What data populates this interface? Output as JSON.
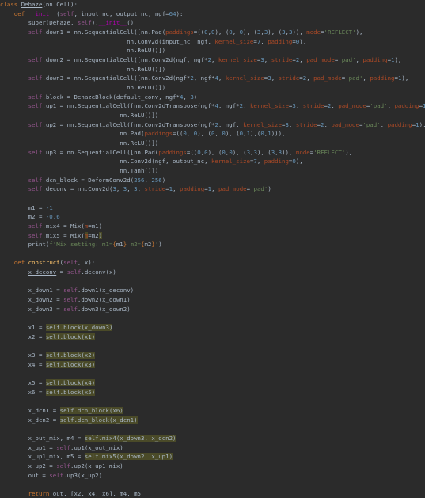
{
  "editor": {
    "language": "python",
    "theme_colors": {
      "background": "#2b2b2b",
      "default": "#a9b7c6",
      "keyword": "#cc7832",
      "self": "#94558d",
      "dunder": "#b200b2",
      "kwarg": "#aa4926",
      "number": "#6897bb",
      "string": "#6a8759",
      "function_name": "#ffc66d",
      "fstring_brace": "#cc7832",
      "highlight_bg": "#4a4a28"
    },
    "lines": [
      [
        {
          "t": "class ",
          "c": "kw"
        },
        {
          "t": "Dehaze",
          "c": "ul"
        },
        {
          "t": "(nn.Cell):"
        }
      ],
      [
        {
          "t": "    "
        },
        {
          "t": "def ",
          "c": "kw"
        },
        {
          "t": "__init__",
          "c": "dunder"
        },
        {
          "t": "("
        },
        {
          "t": "self",
          "c": "self"
        },
        {
          "t": ", input_nc, output_nc, ngf="
        },
        {
          "t": "64",
          "c": "num"
        },
        {
          "t": "):"
        }
      ],
      [
        {
          "t": "        super(Dehaze, "
        },
        {
          "t": "self",
          "c": "self"
        },
        {
          "t": ")."
        },
        {
          "t": "__init__",
          "c": "dunder"
        },
        {
          "t": "()"
        }
      ],
      [
        {
          "t": "        "
        },
        {
          "t": "self",
          "c": "self"
        },
        {
          "t": ".down1 = nn.SequentialCell([nn.Pad("
        },
        {
          "t": "paddings",
          "c": "kwarg"
        },
        {
          "t": "=(("
        },
        {
          "t": "0",
          "c": "num"
        },
        {
          "t": ","
        },
        {
          "t": "0",
          "c": "num"
        },
        {
          "t": "), ("
        },
        {
          "t": "0",
          "c": "num"
        },
        {
          "t": ", "
        },
        {
          "t": "0",
          "c": "num"
        },
        {
          "t": "), ("
        },
        {
          "t": "3",
          "c": "num"
        },
        {
          "t": ","
        },
        {
          "t": "3",
          "c": "num"
        },
        {
          "t": "), ("
        },
        {
          "t": "3",
          "c": "num"
        },
        {
          "t": ","
        },
        {
          "t": "3",
          "c": "num"
        },
        {
          "t": ")), "
        },
        {
          "t": "mode",
          "c": "kwarg"
        },
        {
          "t": "="
        },
        {
          "t": "'REFLECT'",
          "c": "str"
        },
        {
          "t": "),"
        }
      ],
      [
        {
          "t": "                                    nn.Conv2d(input_nc, ngf, "
        },
        {
          "t": "kernel_size",
          "c": "kwarg"
        },
        {
          "t": "="
        },
        {
          "t": "7",
          "c": "num"
        },
        {
          "t": ", "
        },
        {
          "t": "padding",
          "c": "kwarg"
        },
        {
          "t": "="
        },
        {
          "t": "0",
          "c": "num"
        },
        {
          "t": "),"
        }
      ],
      [
        {
          "t": "                                    nn.ReLU()])"
        }
      ],
      [
        {
          "t": "        "
        },
        {
          "t": "self",
          "c": "self"
        },
        {
          "t": ".down2 = nn.SequentialCell([nn.Conv2d(ngf, ngf*"
        },
        {
          "t": "2",
          "c": "num"
        },
        {
          "t": ", "
        },
        {
          "t": "kernel_size",
          "c": "kwarg"
        },
        {
          "t": "="
        },
        {
          "t": "3",
          "c": "num"
        },
        {
          "t": ", "
        },
        {
          "t": "stride",
          "c": "kwarg"
        },
        {
          "t": "="
        },
        {
          "t": "2",
          "c": "num"
        },
        {
          "t": ", "
        },
        {
          "t": "pad_mode",
          "c": "kwarg"
        },
        {
          "t": "="
        },
        {
          "t": "'pad'",
          "c": "str"
        },
        {
          "t": ", "
        },
        {
          "t": "padding",
          "c": "kwarg"
        },
        {
          "t": "="
        },
        {
          "t": "1",
          "c": "num"
        },
        {
          "t": "),"
        }
      ],
      [
        {
          "t": "                                    nn.ReLU()])"
        }
      ],
      [
        {
          "t": "        "
        },
        {
          "t": "self",
          "c": "self"
        },
        {
          "t": ".down3 = nn.SequentialCell([nn.Conv2d(ngf*"
        },
        {
          "t": "2",
          "c": "num"
        },
        {
          "t": ", ngf*"
        },
        {
          "t": "4",
          "c": "num"
        },
        {
          "t": ", "
        },
        {
          "t": "kernel_size",
          "c": "kwarg"
        },
        {
          "t": "="
        },
        {
          "t": "3",
          "c": "num"
        },
        {
          "t": ", "
        },
        {
          "t": "stride",
          "c": "kwarg"
        },
        {
          "t": "="
        },
        {
          "t": "2",
          "c": "num"
        },
        {
          "t": ", "
        },
        {
          "t": "pad_mode",
          "c": "kwarg"
        },
        {
          "t": "="
        },
        {
          "t": "'pad'",
          "c": "str"
        },
        {
          "t": ", "
        },
        {
          "t": "padding",
          "c": "kwarg"
        },
        {
          "t": "="
        },
        {
          "t": "1",
          "c": "num"
        },
        {
          "t": "),"
        }
      ],
      [
        {
          "t": "                                    nn.ReLU()])"
        }
      ],
      [
        {
          "t": "        "
        },
        {
          "t": "self",
          "c": "self"
        },
        {
          "t": ".block = DehazeBlock(default_conv, ngf*"
        },
        {
          "t": "4",
          "c": "num"
        },
        {
          "t": ", "
        },
        {
          "t": "3",
          "c": "num"
        },
        {
          "t": ")"
        }
      ],
      [
        {
          "t": "        "
        },
        {
          "t": "self",
          "c": "self"
        },
        {
          "t": ".up1 = nn.SequentialCell([nn.Conv2dTranspose(ngf*"
        },
        {
          "t": "4",
          "c": "num"
        },
        {
          "t": ", ngf*"
        },
        {
          "t": "2",
          "c": "num"
        },
        {
          "t": ", "
        },
        {
          "t": "kernel_size",
          "c": "kwarg"
        },
        {
          "t": "="
        },
        {
          "t": "3",
          "c": "num"
        },
        {
          "t": ", "
        },
        {
          "t": "stride",
          "c": "kwarg"
        },
        {
          "t": "="
        },
        {
          "t": "2",
          "c": "num"
        },
        {
          "t": ", "
        },
        {
          "t": "pad_mode",
          "c": "kwarg"
        },
        {
          "t": "="
        },
        {
          "t": "'pad'",
          "c": "str"
        },
        {
          "t": ", "
        },
        {
          "t": "padding",
          "c": "kwarg"
        },
        {
          "t": "="
        },
        {
          "t": "1",
          "c": "num"
        },
        {
          "t": "),"
        }
      ],
      [
        {
          "t": "                                  nn.ReLU()])"
        }
      ],
      [
        {
          "t": "        "
        },
        {
          "t": "self",
          "c": "self"
        },
        {
          "t": ".up2 = nn.SequentialCell([nn.Conv2dTranspose(ngf*"
        },
        {
          "t": "2",
          "c": "num"
        },
        {
          "t": ", ngf, "
        },
        {
          "t": "kernel_size",
          "c": "kwarg"
        },
        {
          "t": "="
        },
        {
          "t": "3",
          "c": "num"
        },
        {
          "t": ", "
        },
        {
          "t": "stride",
          "c": "kwarg"
        },
        {
          "t": "="
        },
        {
          "t": "2",
          "c": "num"
        },
        {
          "t": ", "
        },
        {
          "t": "pad_mode",
          "c": "kwarg"
        },
        {
          "t": "="
        },
        {
          "t": "'pad'",
          "c": "str"
        },
        {
          "t": ", "
        },
        {
          "t": "padding",
          "c": "kwarg"
        },
        {
          "t": "="
        },
        {
          "t": "1",
          "c": "num"
        },
        {
          "t": "),"
        }
      ],
      [
        {
          "t": "                                  nn.Pad("
        },
        {
          "t": "paddings",
          "c": "kwarg"
        },
        {
          "t": "=(("
        },
        {
          "t": "0",
          "c": "num"
        },
        {
          "t": ", "
        },
        {
          "t": "0",
          "c": "num"
        },
        {
          "t": "), ("
        },
        {
          "t": "0",
          "c": "num"
        },
        {
          "t": ", "
        },
        {
          "t": "0",
          "c": "num"
        },
        {
          "t": "), ("
        },
        {
          "t": "0",
          "c": "num"
        },
        {
          "t": ","
        },
        {
          "t": "1",
          "c": "num"
        },
        {
          "t": "),("
        },
        {
          "t": "0",
          "c": "num"
        },
        {
          "t": ","
        },
        {
          "t": "1",
          "c": "num"
        },
        {
          "t": "))),"
        }
      ],
      [
        {
          "t": "                                  nn.ReLU()])"
        }
      ],
      [
        {
          "t": "        "
        },
        {
          "t": "self",
          "c": "self"
        },
        {
          "t": ".up3 = nn.SequentialCell([nn.Pad("
        },
        {
          "t": "paddings",
          "c": "kwarg"
        },
        {
          "t": "=(("
        },
        {
          "t": "0",
          "c": "num"
        },
        {
          "t": ","
        },
        {
          "t": "0",
          "c": "num"
        },
        {
          "t": "), ("
        },
        {
          "t": "0",
          "c": "num"
        },
        {
          "t": ","
        },
        {
          "t": "0",
          "c": "num"
        },
        {
          "t": "), ("
        },
        {
          "t": "3",
          "c": "num"
        },
        {
          "t": ","
        },
        {
          "t": "3",
          "c": "num"
        },
        {
          "t": "), ("
        },
        {
          "t": "3",
          "c": "num"
        },
        {
          "t": ","
        },
        {
          "t": "3",
          "c": "num"
        },
        {
          "t": ")), "
        },
        {
          "t": "mode",
          "c": "kwarg"
        },
        {
          "t": "="
        },
        {
          "t": "'REFLECT'",
          "c": "str"
        },
        {
          "t": "),"
        }
      ],
      [
        {
          "t": "                                  nn.Conv2d(ngf, output_nc, "
        },
        {
          "t": "kernel_size",
          "c": "kwarg"
        },
        {
          "t": "="
        },
        {
          "t": "7",
          "c": "num"
        },
        {
          "t": ", "
        },
        {
          "t": "padding",
          "c": "kwarg"
        },
        {
          "t": "="
        },
        {
          "t": "0",
          "c": "num"
        },
        {
          "t": "),"
        }
      ],
      [
        {
          "t": "                                  nn.Tanh()])"
        }
      ],
      [
        {
          "t": "        "
        },
        {
          "t": "self",
          "c": "self"
        },
        {
          "t": ".dcn_block = DeformConv2d("
        },
        {
          "t": "256",
          "c": "num"
        },
        {
          "t": ", "
        },
        {
          "t": "256",
          "c": "num"
        },
        {
          "t": ")"
        }
      ],
      [
        {
          "t": "        "
        },
        {
          "t": "self",
          "c": "self"
        },
        {
          "t": "."
        },
        {
          "t": "deconv",
          "c": "ul"
        },
        {
          "t": " = nn.Conv2d("
        },
        {
          "t": "3",
          "c": "num"
        },
        {
          "t": ", "
        },
        {
          "t": "3",
          "c": "num"
        },
        {
          "t": ", "
        },
        {
          "t": "3",
          "c": "num"
        },
        {
          "t": ", "
        },
        {
          "t": "stride",
          "c": "kwarg"
        },
        {
          "t": "="
        },
        {
          "t": "1",
          "c": "num"
        },
        {
          "t": ", "
        },
        {
          "t": "padding",
          "c": "kwarg"
        },
        {
          "t": "="
        },
        {
          "t": "1",
          "c": "num"
        },
        {
          "t": ", "
        },
        {
          "t": "pad_mode",
          "c": "kwarg"
        },
        {
          "t": "="
        },
        {
          "t": "'pad'",
          "c": "str"
        },
        {
          "t": ")"
        }
      ],
      [],
      [
        {
          "t": "        m1 = "
        },
        {
          "t": "-1",
          "c": "num"
        }
      ],
      [
        {
          "t": "        m2 = "
        },
        {
          "t": "-0.6",
          "c": "num"
        }
      ],
      [
        {
          "t": "        "
        },
        {
          "t": "self",
          "c": "self"
        },
        {
          "t": ".mix4 = Mix("
        },
        {
          "t": "m",
          "c": "kwarg"
        },
        {
          "t": "=m1)"
        }
      ],
      [
        {
          "t": "        "
        },
        {
          "t": "self",
          "c": "self"
        },
        {
          "t": ".mix5 = Mix("
        },
        {
          "t": "m",
          "c": "kwarg-hl"
        },
        {
          "t": "=m2"
        },
        {
          "t": ")",
          "c": "paren-hl"
        }
      ],
      [
        {
          "t": "        print("
        },
        {
          "t": "f'Mix setting: m1=",
          "c": "str"
        },
        {
          "t": "{",
          "c": "fb"
        },
        {
          "t": "m1"
        },
        {
          "t": "}",
          "c": "fb"
        },
        {
          "t": " m2=",
          "c": "str"
        },
        {
          "t": "{",
          "c": "fb"
        },
        {
          "t": "m2"
        },
        {
          "t": "}",
          "c": "fb"
        },
        {
          "t": "'",
          "c": "str"
        },
        {
          "t": ")"
        }
      ],
      [],
      [
        {
          "t": "    "
        },
        {
          "t": "def ",
          "c": "kw"
        },
        {
          "t": "construct",
          "c": "fn"
        },
        {
          "t": "("
        },
        {
          "t": "self",
          "c": "self"
        },
        {
          "t": ", x):"
        }
      ],
      [
        {
          "t": "        "
        },
        {
          "t": "x_deconv",
          "c": "ul"
        },
        {
          "t": " = "
        },
        {
          "t": "self",
          "c": "self"
        },
        {
          "t": ".deconv(x)"
        }
      ],
      [],
      [
        {
          "t": "        x_down1 = "
        },
        {
          "t": "self",
          "c": "self"
        },
        {
          "t": ".down1(x_deconv)"
        }
      ],
      [
        {
          "t": "        x_down2 = "
        },
        {
          "t": "self",
          "c": "self"
        },
        {
          "t": ".down2(x_down1)"
        }
      ],
      [
        {
          "t": "        x_down3 = "
        },
        {
          "t": "self",
          "c": "self"
        },
        {
          "t": ".down3(x_down2)"
        }
      ],
      [],
      [
        {
          "t": "        x1 = "
        },
        {
          "t": "self.block(x_down3)",
          "c": "hl"
        }
      ],
      [
        {
          "t": "        x2 = "
        },
        {
          "t": "self.block(x1)",
          "c": "hl"
        }
      ],
      [],
      [
        {
          "t": "        x3 = "
        },
        {
          "t": "self.block(x2)",
          "c": "hl"
        }
      ],
      [
        {
          "t": "        x4 = "
        },
        {
          "t": "self.block(x3)",
          "c": "hl"
        }
      ],
      [],
      [
        {
          "t": "        x5 = "
        },
        {
          "t": "self.block(x4)",
          "c": "hl"
        }
      ],
      [
        {
          "t": "        x6 = "
        },
        {
          "t": "self.block(x5)",
          "c": "hl"
        }
      ],
      [],
      [
        {
          "t": "        x_dcn1 = "
        },
        {
          "t": "self.dcn_block(x6)",
          "c": "hl"
        }
      ],
      [
        {
          "t": "        x_dcn2 = "
        },
        {
          "t": "self.dcn_block(x_dcn1)",
          "c": "hl"
        }
      ],
      [],
      [
        {
          "t": "        x_out_mix, m4 = "
        },
        {
          "t": "self.mix4(x_down3, x_dcn2)",
          "c": "hl"
        }
      ],
      [
        {
          "t": "        x_up1 = "
        },
        {
          "t": "self",
          "c": "self"
        },
        {
          "t": ".up1(x_out_mix)"
        }
      ],
      [
        {
          "t": "        x_up1_mix, m5 = "
        },
        {
          "t": "self.mix5(x_down2, x_up1)",
          "c": "hl"
        }
      ],
      [
        {
          "t": "        x_up2 = "
        },
        {
          "t": "self",
          "c": "self"
        },
        {
          "t": ".up2(x_up1_mix)"
        }
      ],
      [
        {
          "t": "        out = "
        },
        {
          "t": "self",
          "c": "self"
        },
        {
          "t": ".up3(x_up2)"
        }
      ],
      [],
      [
        {
          "t": "        "
        },
        {
          "t": "return ",
          "c": "kw"
        },
        {
          "t": "out, [x2, x4, x6], m4, m5"
        }
      ]
    ]
  }
}
